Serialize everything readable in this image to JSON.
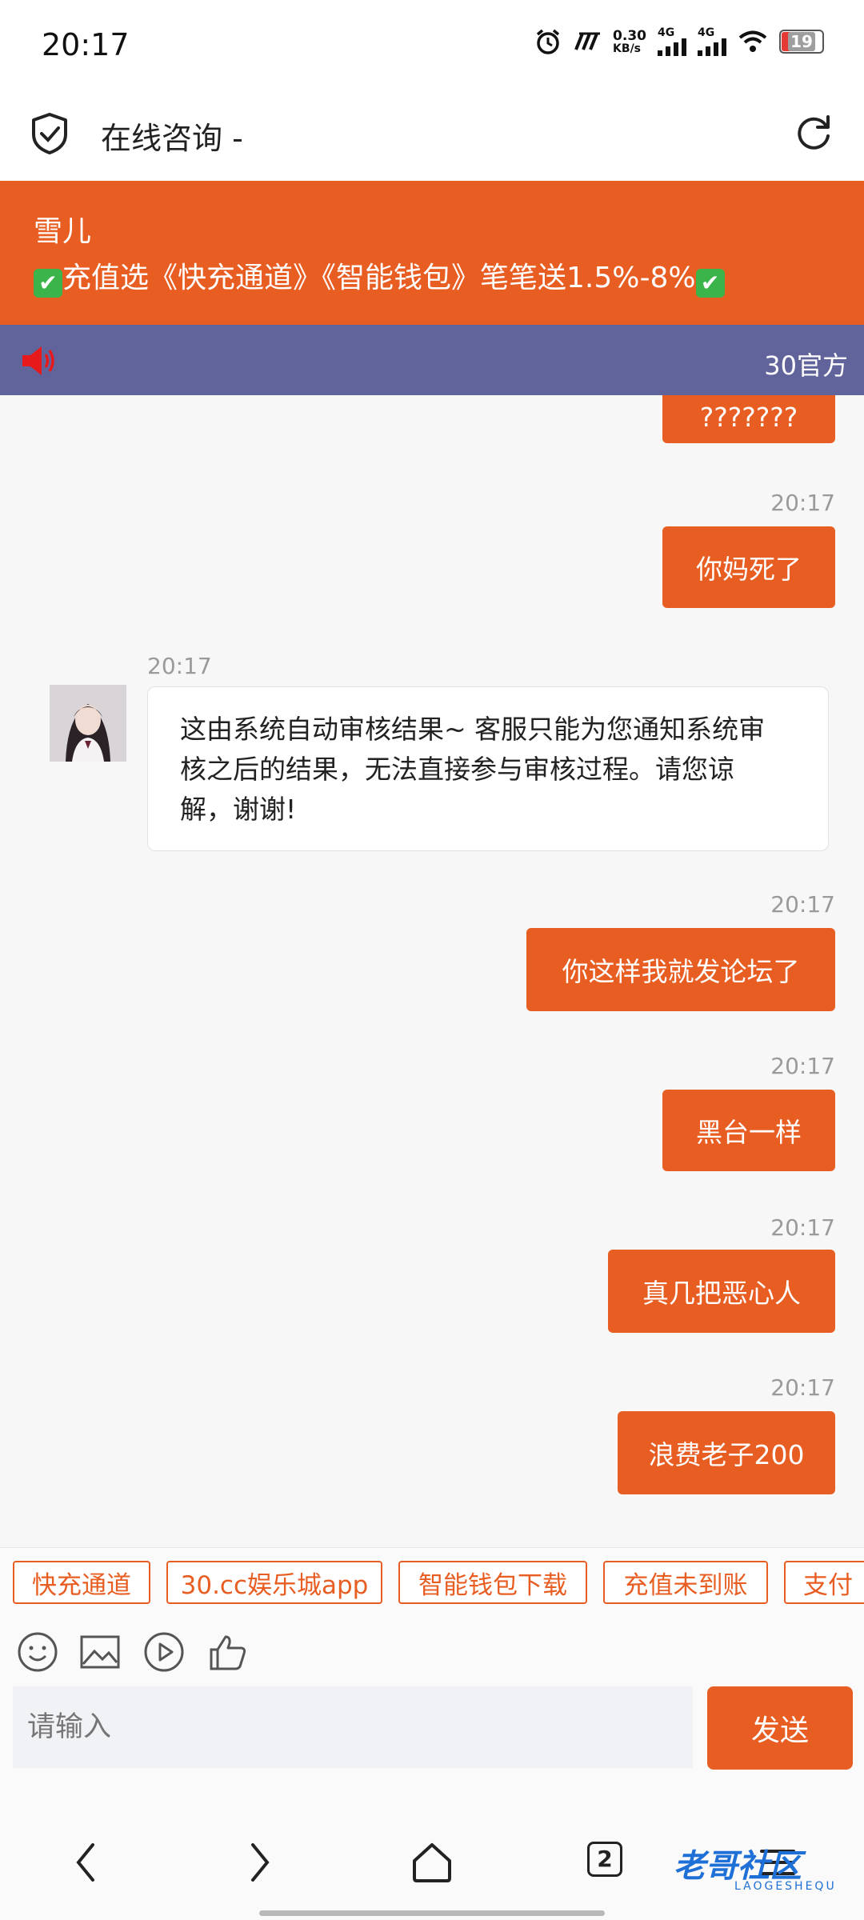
{
  "status_bar": {
    "time": "20:17",
    "net_speed_value": "0.30",
    "net_speed_unit": "KB/s",
    "net1": "4G",
    "net2": "4G",
    "battery": "19",
    "icons": [
      "alarm-icon",
      "carrier-logo-icon",
      "signal-icon",
      "signal-icon",
      "wifi-icon",
      "battery-icon"
    ]
  },
  "header": {
    "title": "在线咨询 -"
  },
  "notice": {
    "agent_name": "雪儿",
    "promo": "充值选《快充通道》《智能钱包》笔笔送1.5%-8%"
  },
  "marquee": {
    "text": "30官方"
  },
  "messages": [
    {
      "type": "out",
      "text": "???????"
    },
    {
      "type": "out",
      "time": "20:17",
      "text": "你妈死了"
    },
    {
      "type": "in",
      "time": "20:17",
      "line1": "这由系统自动审核结果~ 客服只能为您通知系统审",
      "line2": "核之后的结果，无法直接参与审核过程。请您谅",
      "line3": "解，谢谢!"
    },
    {
      "type": "out",
      "time": "20:17",
      "text": "你这样我就发论坛了"
    },
    {
      "type": "out",
      "time": "20:17",
      "text": "黑台一样"
    },
    {
      "type": "out",
      "time": "20:17",
      "text": "真几把恶心人"
    },
    {
      "type": "out",
      "time": "20:17",
      "text": "浪费老子200"
    }
  ],
  "quick_replies": [
    "快充通道",
    "30.cc娱乐城app",
    "智能钱包下载",
    "充值未到账",
    "支付"
  ],
  "input": {
    "placeholder": "请输入",
    "send_label": "发送"
  },
  "bottom_nav": {
    "tab_count": "2"
  },
  "watermark": {
    "main": "老哥社区",
    "sub": "LAOGESHEQU"
  },
  "colors": {
    "accent": "#e85d22",
    "marquee_bg": "#61649b",
    "chat_bg": "#f7f7f7"
  }
}
